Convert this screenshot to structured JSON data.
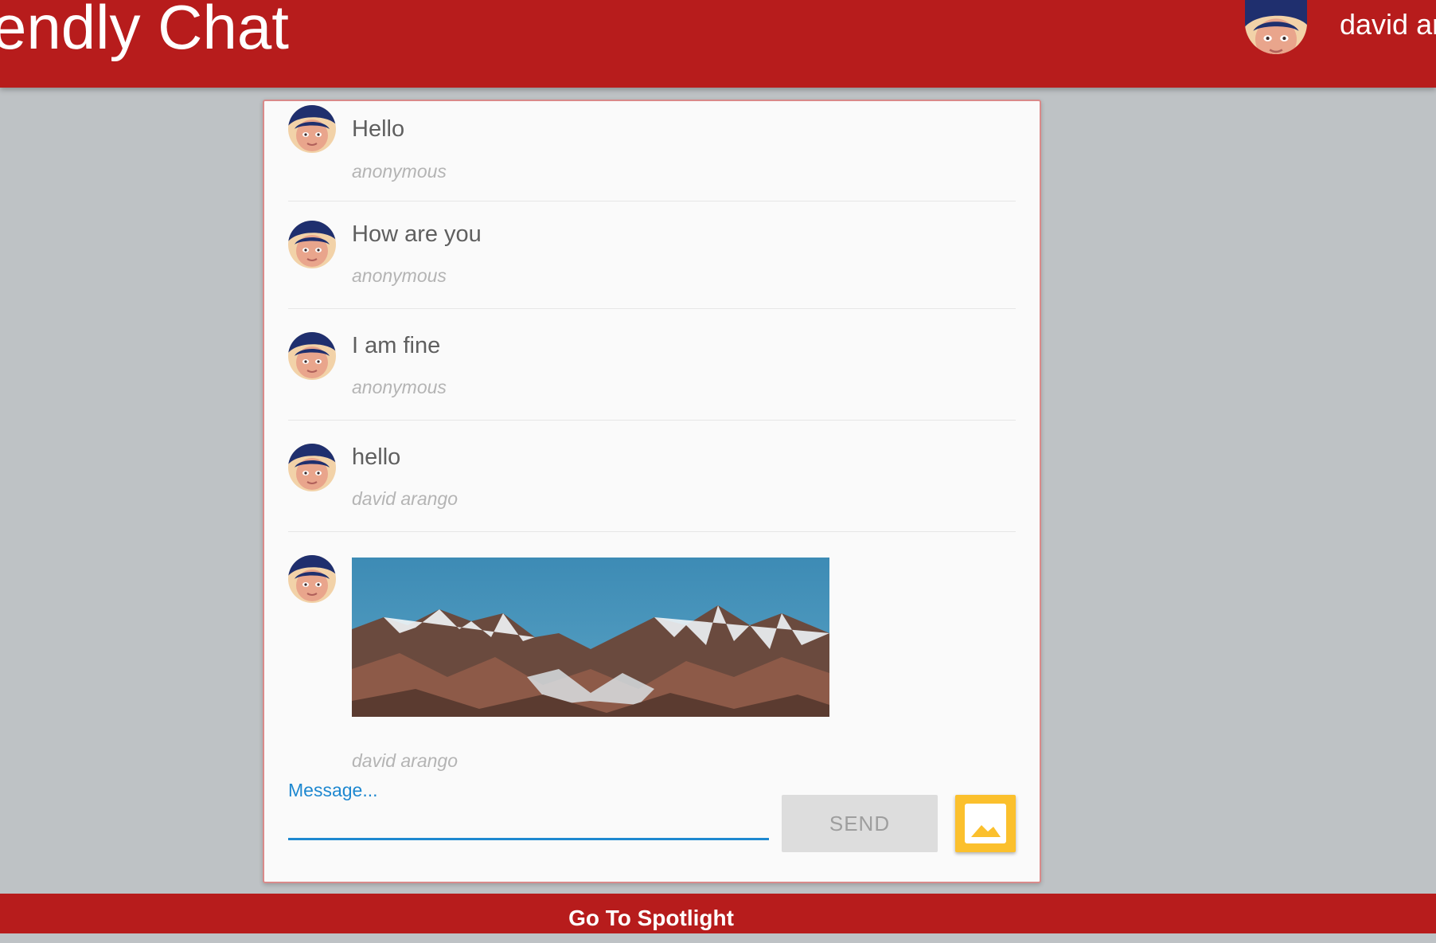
{
  "header": {
    "title": "endly Chat",
    "user_name": "david ara"
  },
  "messages": [
    {
      "text": "Hello",
      "author": "anonymous",
      "type": "text"
    },
    {
      "text": "How are you",
      "author": "anonymous",
      "type": "text"
    },
    {
      "text": "I am fine",
      "author": "anonymous",
      "type": "text"
    },
    {
      "text": "hello",
      "author": "david arango",
      "type": "text"
    },
    {
      "author": "david arango",
      "type": "image",
      "image_icon": "mountain-landscape-image"
    }
  ],
  "composer": {
    "placeholder": "Message...",
    "send_label": "SEND",
    "image_button_icon": "image-icon"
  },
  "footer": {
    "link_label": "Go To Spotlight"
  },
  "colors": {
    "header": "#b71c1c",
    "background": "#bec2c5",
    "accent_blue": "#1e88d0",
    "image_button": "#fbc02d"
  }
}
